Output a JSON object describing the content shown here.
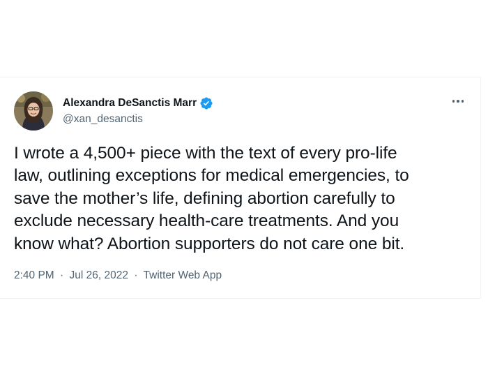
{
  "tweet": {
    "author": {
      "display_name": "Alexandra DeSanctis Marr",
      "handle": "@xan_desanctis",
      "verified": true
    },
    "text": "I wrote a 4,500+ piece with the text of every pro-life\nlaw, outlining exceptions for medical emergencies, to\nsave the mother’s life, defining abortion carefully to\nexclude necessary health-care treatments. And you\nknow what? Abortion supporters do not care one bit.",
    "time": "2:40 PM",
    "date": "Jul 26, 2022",
    "source": "Twitter Web App",
    "separator": "·"
  },
  "icons": {
    "verified": "verified-badge-icon",
    "more": "more-options-icon"
  },
  "colors": {
    "text_primary": "#0f1419",
    "text_secondary": "#536471",
    "verified_blue": "#1d9bf0",
    "border": "#eff3f4"
  }
}
